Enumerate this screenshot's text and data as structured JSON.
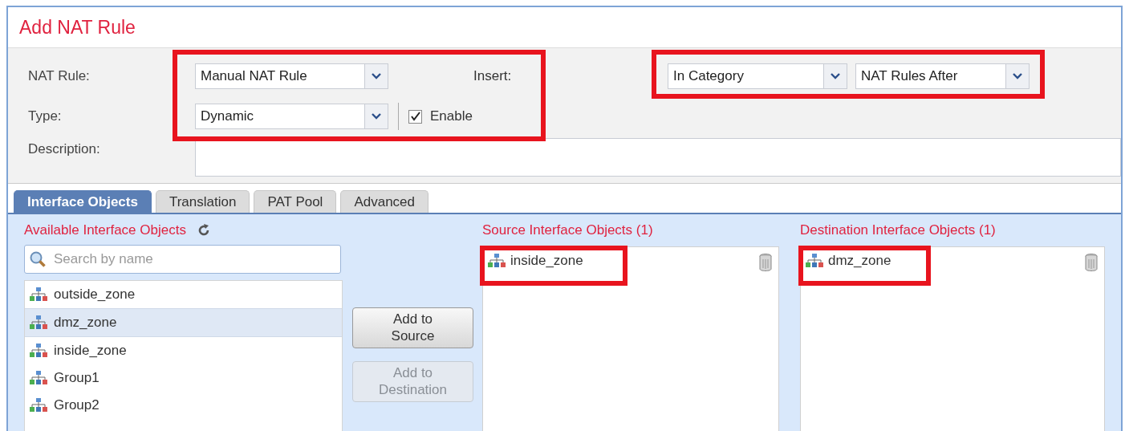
{
  "title": "Add NAT Rule",
  "form": {
    "nat_rule": {
      "label": "NAT Rule:",
      "value": "Manual NAT Rule"
    },
    "insert": {
      "label": "Insert:",
      "category": "In Category",
      "position": "NAT Rules After"
    },
    "type": {
      "label": "Type:",
      "value": "Dynamic"
    },
    "enable": {
      "label": "Enable",
      "checked": true
    },
    "description": {
      "label": "Description:"
    }
  },
  "tabs": [
    {
      "label": "Interface Objects",
      "selected": true
    },
    {
      "label": "Translation",
      "selected": false
    },
    {
      "label": "PAT Pool",
      "selected": false
    },
    {
      "label": "Advanced",
      "selected": false
    }
  ],
  "available": {
    "title": "Available Interface Objects",
    "placeholder": "Search by name",
    "items": [
      {
        "name": "outside_zone",
        "selected": false
      },
      {
        "name": "dmz_zone",
        "selected": true
      },
      {
        "name": "inside_zone",
        "selected": false
      },
      {
        "name": "Group1",
        "selected": false
      },
      {
        "name": "Group2",
        "selected": false
      }
    ]
  },
  "buttons": [
    {
      "label": "Add to Source",
      "disabled": false
    },
    {
      "label": "Add to Destination",
      "disabled": true
    }
  ],
  "source": {
    "title": "Source Interface Objects (1)",
    "items": [
      "inside_zone"
    ]
  },
  "destination": {
    "title": "Destination Interface Objects (1)",
    "items": [
      "dmz_zone"
    ]
  }
}
